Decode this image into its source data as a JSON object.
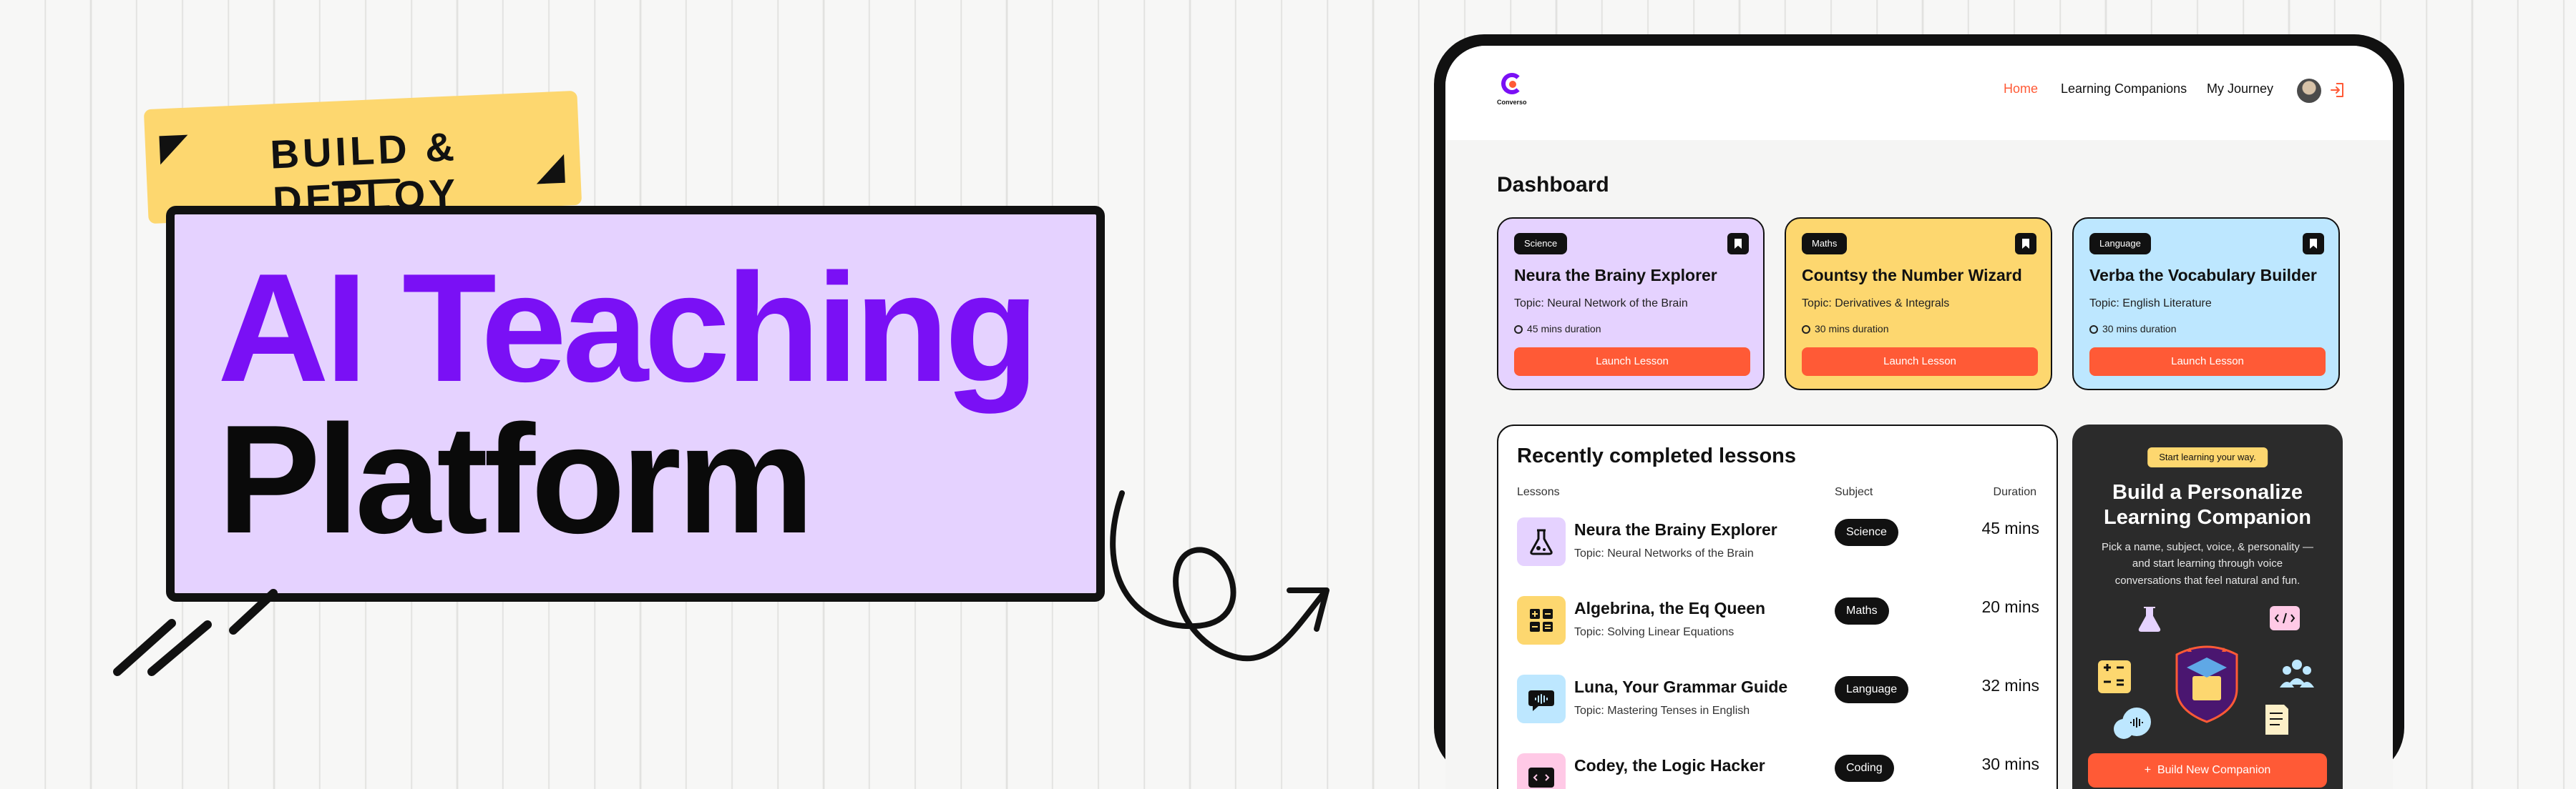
{
  "hero": {
    "badge_text": "BUILD & DEPLOY",
    "title_line1": "AI Teaching",
    "title_line2": "Platform"
  },
  "app": {
    "logo_text": "Converso",
    "nav": [
      {
        "label": "Home",
        "active": true
      },
      {
        "label": "Learning Companions",
        "active": false
      },
      {
        "label": "My Journey",
        "active": false
      }
    ],
    "dashboard_title": "Dashboard",
    "cards": [
      {
        "subject": "Science",
        "name": "Neura the Brainy Explorer",
        "topic": "Topic: Neural Network of the Brain",
        "duration": "45 mins duration",
        "button": "Launch Lesson",
        "color": "#e5d2ff"
      },
      {
        "subject": "Maths",
        "name": "Countsy the Number Wizard",
        "topic": "Topic: Derivatives & Integrals",
        "duration": "30 mins duration",
        "button": "Launch Lesson",
        "color": "#fdd76f"
      },
      {
        "subject": "Language",
        "name": "Verba the Vocabulary Builder",
        "topic": "Topic: English Literature",
        "duration": "30 mins duration",
        "button": "Launch Lesson",
        "color": "#bde7ff"
      }
    ],
    "recent": {
      "title": "Recently completed lessons",
      "columns": [
        "Lessons",
        "Subject",
        "Duration"
      ],
      "rows": [
        {
          "name": "Neura the Brainy Explorer",
          "topic": "Topic: Neural Networks of the Brain",
          "subject": "Science",
          "duration": "45 mins",
          "icon": "flask-icon",
          "color": "#e5d2ff"
        },
        {
          "name": "Algebrina, the Eq Queen",
          "topic": "Topic: Solving Linear Equations",
          "subject": "Maths",
          "duration": "20 mins",
          "icon": "calculator-icon",
          "color": "#fdd76f"
        },
        {
          "name": "Luna, Your Grammar Guide",
          "topic": "Topic: Mastering Tenses in English",
          "subject": "Language",
          "duration": "32 mins",
          "icon": "speech-icon",
          "color": "#bde7ff"
        },
        {
          "name": "Codey, the Logic Hacker",
          "topic": "",
          "subject": "Coding",
          "duration": "30 mins",
          "icon": "code-icon",
          "color": "#ffc9e6"
        }
      ]
    },
    "cta": {
      "pill": "Start learning your way.",
      "title": "Build a Personalize Learning Companion",
      "description": "Pick a name, subject, voice, & personality — and start learning through voice conversations that feel natural and fun.",
      "button": "Build New Companion"
    }
  }
}
